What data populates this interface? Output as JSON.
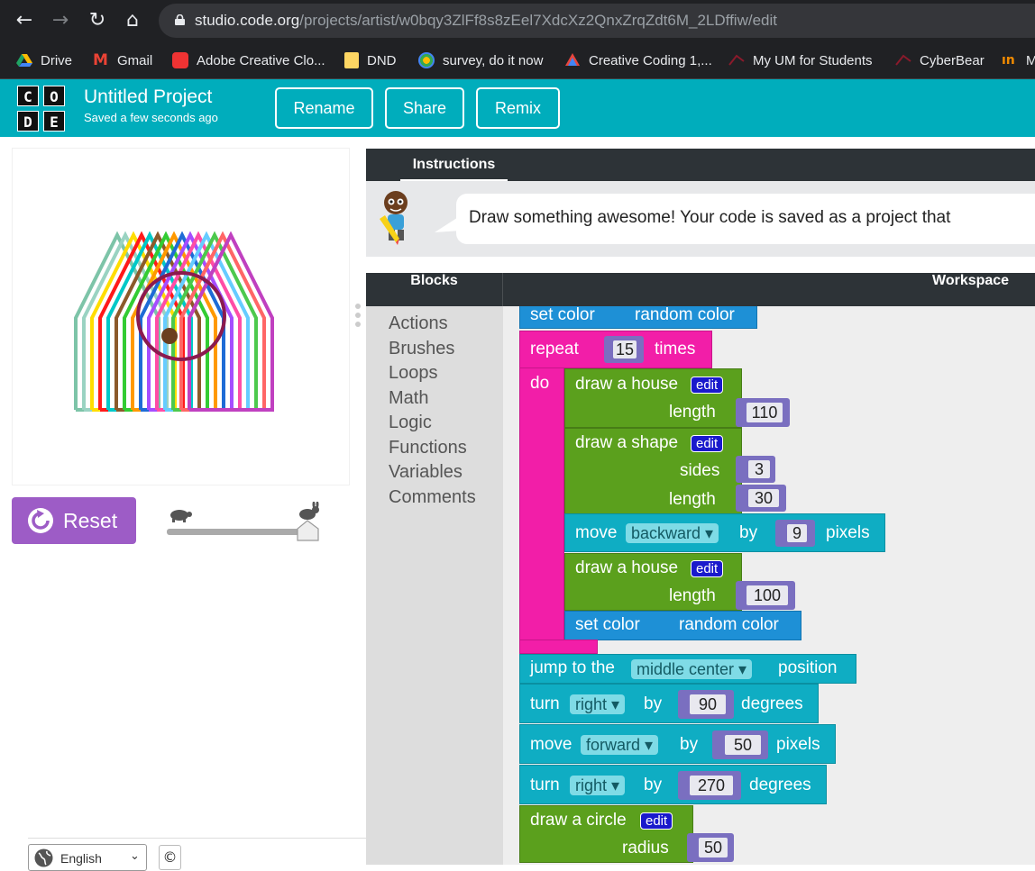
{
  "browser": {
    "url_domain": "studio.code.org",
    "url_path": "/projects/artist/w0bqy3ZlFf8s8zEel7XdcXz2QnxZrqZdt6M_2LDffiw/edit",
    "bookmarks": [
      "Drive",
      "Gmail",
      "Adobe Creative Clo...",
      "DND",
      "survey, do it now",
      "Creative Coding 1,...",
      "My UM for Students",
      "CyberBear",
      "M"
    ]
  },
  "header": {
    "logo": [
      "C",
      "O",
      "D",
      "E"
    ],
    "title": "Untitled Project",
    "saved": "Saved a few seconds ago",
    "buttons": {
      "rename": "Rename",
      "share": "Share",
      "remix": "Remix"
    },
    "color": "#00adbc"
  },
  "left": {
    "reset_label": "Reset",
    "language": "English",
    "copyright": "©",
    "speed_level": 1.0
  },
  "instructions": {
    "tab": "Instructions",
    "text": "Draw something awesome! Your code is saved as a project that"
  },
  "blocks_panel": {
    "blocks_title": "Blocks",
    "workspace_title": "Workspace",
    "categories": [
      "Actions",
      "Brushes",
      "Loops",
      "Math",
      "Logic",
      "Functions",
      "Variables",
      "Comments"
    ]
  },
  "code": {
    "set_color_1": {
      "label": "set color",
      "value": "random color"
    },
    "repeat": {
      "label": "repeat",
      "count": "15",
      "times": "times",
      "do": "do"
    },
    "house1": {
      "label": "draw a house",
      "edit": "edit",
      "param": "length",
      "value": "110"
    },
    "shape": {
      "label": "draw a shape",
      "edit": "edit",
      "param1": "sides",
      "value1": "3",
      "param2": "length",
      "value2": "30"
    },
    "move_back": {
      "label": "move",
      "dir": "backward ▾",
      "by": "by",
      "value": "9",
      "unit": "pixels"
    },
    "house2": {
      "label": "draw a house",
      "edit": "edit",
      "param": "length",
      "value": "100"
    },
    "set_color_2": {
      "label": "set color",
      "value": "random color"
    },
    "jump": {
      "label": "jump to the",
      "pos": "middle center ▾",
      "suffix": "position"
    },
    "turn1": {
      "label": "turn",
      "dir": "right ▾",
      "by": "by",
      "value": "90",
      "unit": "degrees"
    },
    "move_fwd": {
      "label": "move",
      "dir": "forward ▾",
      "by": "by",
      "value": "50",
      "unit": "pixels"
    },
    "turn2": {
      "label": "turn",
      "dir": "right ▾",
      "by": "by",
      "value": "270",
      "unit": "degrees"
    },
    "circle": {
      "label": "draw a circle",
      "edit": "edit",
      "param": "radius",
      "value": "50"
    }
  },
  "canvas_colors": [
    "#7dc4a8",
    "#9ad3c2",
    "#ffdd00",
    "#ff1a1a",
    "#00c8c8",
    "#8b5a2b",
    "#33cc33",
    "#ff9900",
    "#1e6bd6",
    "#a64dff",
    "#ff4da6",
    "#66ccff",
    "#4dc94d",
    "#ff6666",
    "#c040c0"
  ]
}
